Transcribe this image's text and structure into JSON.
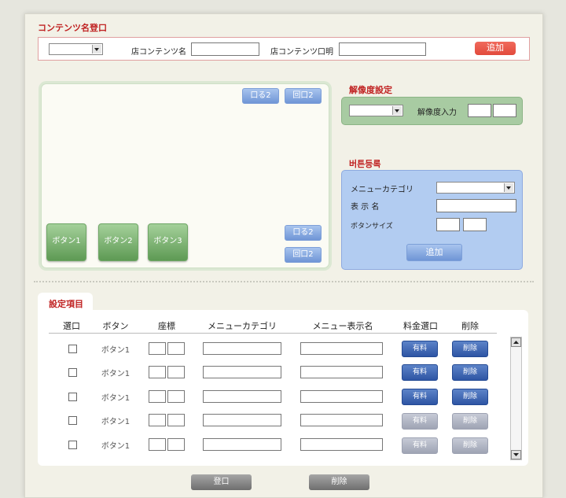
{
  "register": {
    "title": "コンテンツ名登口",
    "name_label": "店コンテンツ名",
    "desc_label": "店コンテンツ口明",
    "add_label": "追加"
  },
  "preview": {
    "top_btn_1": "口る2",
    "top_btn_2": "回口2",
    "bottom_btn_1": "口る2",
    "bottom_btn_2": "回口2",
    "buttons": [
      "ボタン1",
      "ボタン2",
      "ボタン3"
    ]
  },
  "resolution": {
    "title": "解像度設定",
    "input_label": "解像度入力"
  },
  "button_register": {
    "title": "버튼등록",
    "category_label": "メニューカテゴリ",
    "display_name_label": "表 示 名",
    "size_label": "ボタンサイズ",
    "add_label": "追加"
  },
  "settings": {
    "title": "設定項目",
    "headers": [
      "選口",
      "ボタン",
      "座標",
      "メニューカテゴリ",
      "メニュー表示名",
      "料金選口",
      "削除"
    ],
    "rows": [
      {
        "button": "ボタン1",
        "fee": "有料",
        "delete": "削除",
        "active": true
      },
      {
        "button": "ボタン1",
        "fee": "有料",
        "delete": "削除",
        "active": true
      },
      {
        "button": "ボタン1",
        "fee": "有料",
        "delete": "削除",
        "active": true
      },
      {
        "button": "ボタン1",
        "fee": "有料",
        "delete": "削除",
        "active": false
      },
      {
        "button": "ボタン1",
        "fee": "有料",
        "delete": "削除",
        "active": false
      }
    ]
  },
  "footer": {
    "register_label": "登口",
    "delete_label": "削除"
  }
}
